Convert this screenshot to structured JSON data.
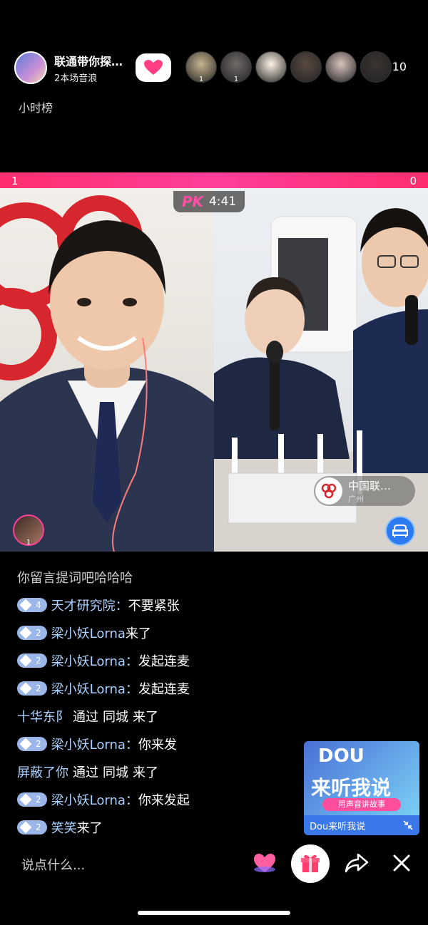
{
  "header": {
    "host_name": "联通带你探…",
    "host_sub": "2本场音浪",
    "viewer_count": "10",
    "viewers": [
      {
        "rank": "1",
        "color": "#c9b590"
      },
      {
        "rank": "1",
        "color": "#6f6a68"
      },
      {
        "rank": "",
        "color": "#fff3e6"
      },
      {
        "rank": "",
        "color": "#5a4a42"
      },
      {
        "rank": "",
        "color": "#d8c3be"
      },
      {
        "rank": "",
        "color": "#3a3432"
      }
    ]
  },
  "hour_rank": "小时榜",
  "pk": {
    "left_score": "1",
    "right_score": "0",
    "logo": "PK",
    "time": "4:41"
  },
  "mini_avatar_rank": "1",
  "opponent": {
    "name": "中国联…",
    "city": "广州"
  },
  "chat": [
    {
      "user": "",
      "level": "",
      "text": "你留言提词吧哈哈哈"
    },
    {
      "user": "天才研究院",
      "level": "4",
      "text": "不要紧张",
      "sep": "："
    },
    {
      "user": "梁小妖Lorna",
      "level": "2",
      "text": "来了",
      "sep": " "
    },
    {
      "user": "梁小妖Lorna",
      "level": "2",
      "text": "发起连麦",
      "sep": "："
    },
    {
      "user": "梁小妖Lorna",
      "level": "2",
      "text": "发起连麦",
      "sep": "："
    },
    {
      "user": "十华东阝",
      "level": "",
      "via": "通过",
      "via_src": "同城",
      "text": "来了"
    },
    {
      "user": "梁小妖Lorna",
      "level": "2",
      "text": "你来发",
      "sep": "："
    },
    {
      "user": "屏蔽了你",
      "level": "",
      "via": "通过",
      "via_src": "同城",
      "text": "来了"
    },
    {
      "user": "梁小妖Lorna",
      "level": "2",
      "text": "你来发起",
      "sep": "："
    },
    {
      "user": "笑笑",
      "level": "2",
      "text": "来了",
      "sep": " "
    }
  ],
  "promo": {
    "brand": "DOU",
    "title": "来听我说",
    "tag": "用声音讲故事",
    "footer": "Dou来听我说"
  },
  "bottom": {
    "input_placeholder": "说点什么..."
  },
  "colors": {
    "accent_pink": "#ff3e9a",
    "username_blue": "#aad1ff"
  }
}
